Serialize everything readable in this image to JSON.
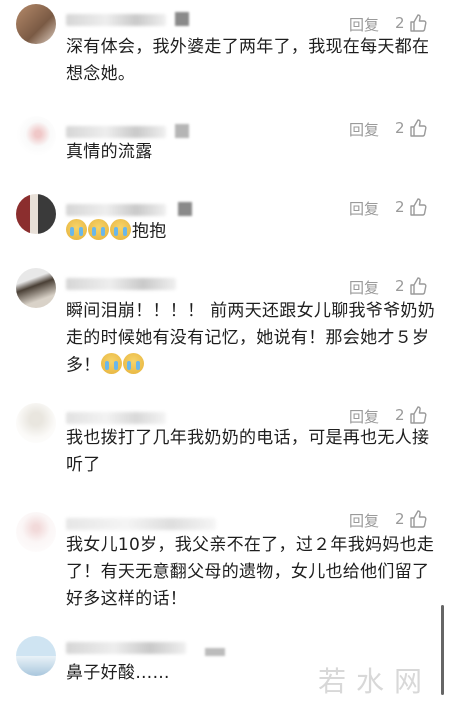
{
  "comments": [
    {
      "text": "深有体会，我外婆走了两年了，我现在每天都在想念她。",
      "reply": "回复",
      "likes": "2"
    },
    {
      "text": "真情的流露",
      "reply": "回复",
      "likes": "2"
    },
    {
      "text": "抱抱",
      "reply": "回复",
      "likes": "2"
    },
    {
      "text": "瞬间泪崩！！！！ 前两天还跟女儿聊我爷爷奶奶走的时候她有没有记忆，她说有！那会她才５岁多！",
      "reply": "回复",
      "likes": "2"
    },
    {
      "text": "我也拨打了几年我奶奶的电话，可是再也无人接听了",
      "reply": "回复",
      "likes": "2"
    },
    {
      "text": "我女儿10岁，我父亲不在了，过２年我妈妈也走了！有天无意翻父母的遗物，女儿也给他们留了好多这样的话！",
      "reply": "回复",
      "likes": "2"
    },
    {
      "text": "鼻子好酸……"
    }
  ],
  "watermark": "若水网",
  "colors": {
    "meta": "#9a9a9a",
    "text": "#1e1e1e"
  },
  "icons": {
    "like": "thumbs-up-icon",
    "emoji": "crying-face-emoji"
  }
}
